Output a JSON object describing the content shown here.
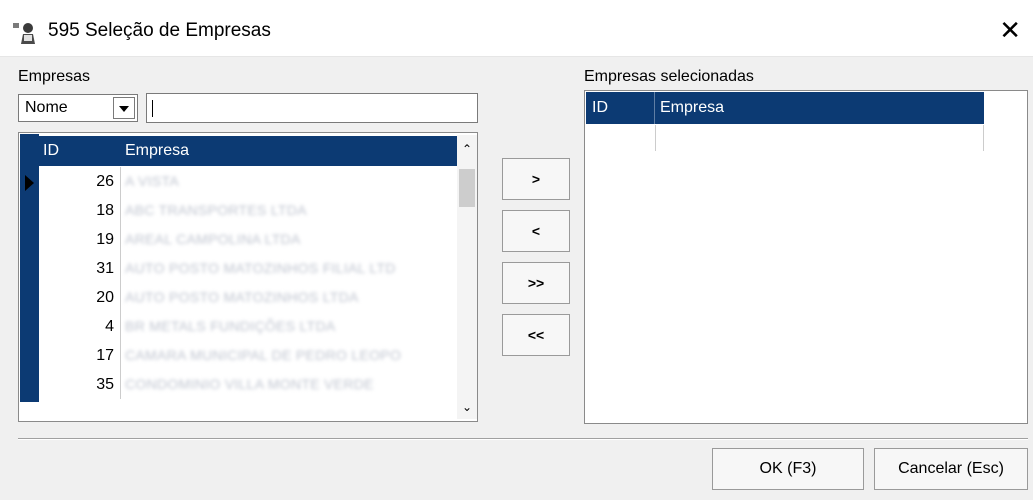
{
  "window": {
    "title": "595 Seleção de Empresas",
    "icon": "app-person-icon",
    "close_glyph": "✕"
  },
  "left_panel": {
    "label": "Empresas",
    "filter_field": {
      "selected": "Nome"
    },
    "search": {
      "value": ""
    },
    "grid": {
      "columns": [
        "ID",
        "Empresa"
      ],
      "rows": [
        {
          "id": "26",
          "name": "A VISTA"
        },
        {
          "id": "18",
          "name": "ABC TRANSPORTES LTDA"
        },
        {
          "id": "19",
          "name": "AREAL CAMPOLINA LTDA"
        },
        {
          "id": "31",
          "name": "AUTO POSTO MATOZINHOS FILIAL LTD"
        },
        {
          "id": "20",
          "name": "AUTO POSTO MATOZINHOS LTDA"
        },
        {
          "id": "4",
          "name": "BR METALS FUNDIÇÕES LTDA"
        },
        {
          "id": "17",
          "name": "CAMARA MUNICIPAL DE PEDRO LEOPO"
        },
        {
          "id": "35",
          "name": "CONDOMINIO VILLA MONTE VERDE"
        }
      ]
    }
  },
  "move_buttons": {
    "add_one": ">",
    "remove_one": "<",
    "add_all": ">>",
    "remove_all": "<<"
  },
  "right_panel": {
    "label": "Empresas selecionadas",
    "grid": {
      "columns": [
        "ID",
        "Empresa"
      ],
      "rows": []
    }
  },
  "actions": {
    "ok": "OK (F3)",
    "cancel": "Cancelar (Esc)"
  },
  "colors": {
    "header_bg": "#0c3a73",
    "dialog_bg": "#f0f0f0"
  }
}
